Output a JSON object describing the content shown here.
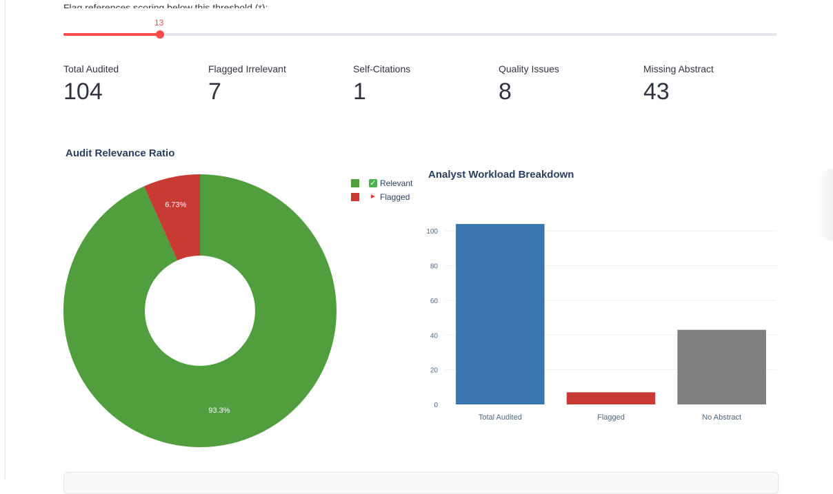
{
  "slider": {
    "label": "Flag references scoring below this threshold (τ):",
    "value": "13",
    "value_fraction": 0.135,
    "color": "#ff4b4b"
  },
  "metrics": [
    {
      "label": "Total Audited",
      "value": "104"
    },
    {
      "label": "Flagged Irrelevant",
      "value": "7"
    },
    {
      "label": "Self-Citations",
      "value": "1"
    },
    {
      "label": "Quality Issues",
      "value": "8"
    },
    {
      "label": "Missing Abstract",
      "value": "43"
    }
  ],
  "chart_data": [
    {
      "type": "pie",
      "title": "Audit Relevance Ratio",
      "hole": true,
      "labels": [
        "Relevant",
        "Flagged"
      ],
      "legend_glyphs": [
        "check-icon",
        "flag-icon"
      ],
      "values": [
        93.3,
        6.73
      ],
      "display_labels": [
        "93.3%",
        "6.73%"
      ],
      "colors": [
        "#519e3e",
        "#c83a34"
      ],
      "legend_position": "top-right"
    },
    {
      "type": "bar",
      "title": "Analyst Workload Breakdown",
      "categories": [
        "Total Audited",
        "Flagged",
        "No Abstract"
      ],
      "values": [
        104,
        7,
        43
      ],
      "colors": [
        "#3a75af",
        "#c83a34",
        "#7f7f7f"
      ],
      "ylim": [
        0,
        110
      ],
      "yticks": [
        0,
        20,
        40,
        60,
        80,
        100
      ],
      "grid": true
    }
  ]
}
